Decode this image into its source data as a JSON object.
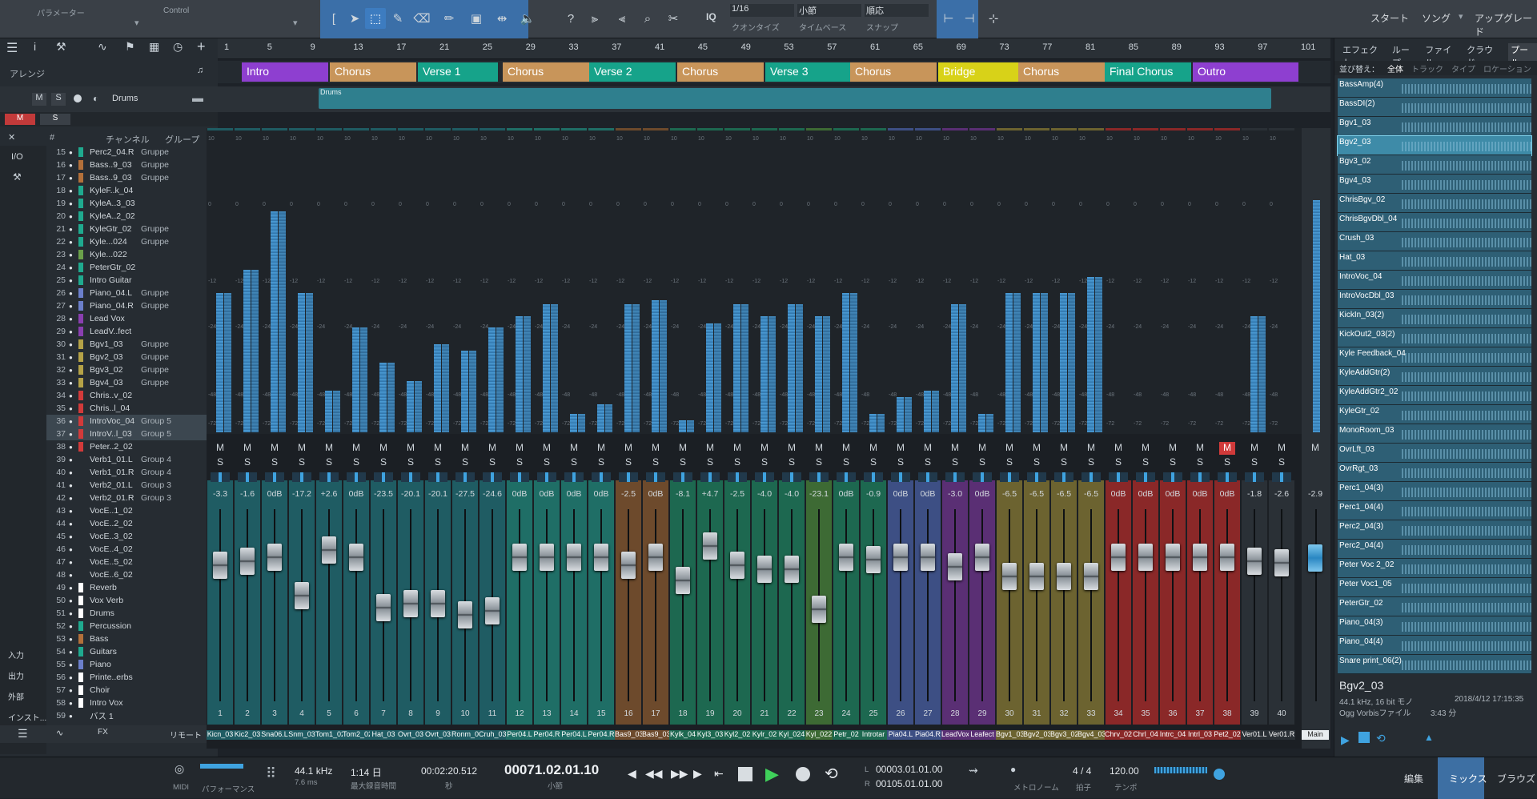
{
  "toolbar": {
    "param_label": "パラメーター",
    "control_label": "Control",
    "iq": "IQ",
    "quantize": "1/16",
    "quantize_label": "クオンタイズ",
    "timebase": "小節",
    "timebase_label": "タイムベース",
    "snap": "順応",
    "snap_label": "スナップ",
    "start": "スタート",
    "song": "ソング",
    "upgrade": "アップグレード"
  },
  "arrange": {
    "label": "アレンジ",
    "ruler": [
      "1",
      "5",
      "9",
      "13",
      "17",
      "21",
      "25",
      "29",
      "33",
      "37",
      "41",
      "45",
      "49",
      "53",
      "57",
      "61",
      "65",
      "69",
      "73",
      "77",
      "81",
      "85",
      "89",
      "93",
      "97",
      "101"
    ],
    "timesig": "4/4",
    "markers": [
      {
        "label": "Intro",
        "color": "#8e3fd0"
      },
      {
        "label": "Chorus",
        "color": "#c8955a"
      },
      {
        "label": "Verse 1",
        "color": "#16a38a"
      },
      {
        "label": "Chorus",
        "color": "#c8955a"
      },
      {
        "label": "Verse 2",
        "color": "#16a38a"
      },
      {
        "label": "Chorus",
        "color": "#c8955a"
      },
      {
        "label": "Verse 3",
        "color": "#16a38a"
      },
      {
        "label": "Chorus",
        "color": "#c8955a"
      },
      {
        "label": "Bridge",
        "color": "#d8d218"
      },
      {
        "label": "Chorus",
        "color": "#c8955a"
      },
      {
        "label": "Final Chorus",
        "color": "#16a38a"
      },
      {
        "label": "Outro",
        "color": "#8e3fd0"
      }
    ]
  },
  "track": {
    "name": "Drums",
    "clip": "Drums",
    "m": "M",
    "s": "S"
  },
  "channels": {
    "col_num": "#",
    "col_channel": "チャンネル",
    "col_group": "グループ",
    "io": "I/O",
    "rows": [
      {
        "n": "15",
        "name": "Perc2_04.R",
        "grp": "Gruppe",
        "c": "#1faa8f"
      },
      {
        "n": "16",
        "name": "Bass..9_03",
        "grp": "Gruppe",
        "c": "#b3703a"
      },
      {
        "n": "17",
        "name": "Bass..9_03",
        "grp": "Gruppe",
        "c": "#b3703a"
      },
      {
        "n": "18",
        "name": "KyleF..k_04",
        "grp": "",
        "c": "#1faa8f"
      },
      {
        "n": "19",
        "name": "KyleA..3_03",
        "grp": "",
        "c": "#1faa8f"
      },
      {
        "n": "20",
        "name": "KyleA..2_02",
        "grp": "",
        "c": "#1faa8f"
      },
      {
        "n": "21",
        "name": "KyleGtr_02",
        "grp": "Gruppe",
        "c": "#1faa8f"
      },
      {
        "n": "22",
        "name": "Kyle...024",
        "grp": "Gruppe",
        "c": "#1faa8f"
      },
      {
        "n": "23",
        "name": "Kyle...022",
        "grp": "",
        "c": "#6aa04a"
      },
      {
        "n": "24",
        "name": "PeterGtr_02",
        "grp": "",
        "c": "#1faa8f"
      },
      {
        "n": "25",
        "name": "Intro Guitar",
        "grp": "",
        "c": "#1faa8f"
      },
      {
        "n": "26",
        "name": "Piano_04.L",
        "grp": "Gruppe",
        "c": "#6b7fcb"
      },
      {
        "n": "27",
        "name": "Piano_04.R",
        "grp": "Gruppe",
        "c": "#6b7fcb"
      },
      {
        "n": "28",
        "name": "Lead Vox",
        "grp": "",
        "c": "#8a3fb0"
      },
      {
        "n": "29",
        "name": "LeadV..fect",
        "grp": "",
        "c": "#8a3fb0"
      },
      {
        "n": "30",
        "name": "Bgv1_03",
        "grp": "Gruppe",
        "c": "#b5a247"
      },
      {
        "n": "31",
        "name": "Bgv2_03",
        "grp": "Gruppe",
        "c": "#b5a247"
      },
      {
        "n": "32",
        "name": "Bgv3_02",
        "grp": "Gruppe",
        "c": "#b5a247"
      },
      {
        "n": "33",
        "name": "Bgv4_03",
        "grp": "Gruppe",
        "c": "#b5a247"
      },
      {
        "n": "34",
        "name": "Chris..v_02",
        "grp": "",
        "c": "#d23a3a"
      },
      {
        "n": "35",
        "name": "Chris..l_04",
        "grp": "",
        "c": "#d23a3a"
      },
      {
        "n": "36",
        "name": "IntroVoc_04",
        "grp": "Group 5",
        "c": "#d23a3a"
      },
      {
        "n": "37",
        "name": "IntroV..l_03",
        "grp": "Group 5",
        "c": "#d23a3a"
      },
      {
        "n": "38",
        "name": "Peter..2_02",
        "grp": "",
        "c": "#d23a3a"
      },
      {
        "n": "39",
        "name": "Verb1_01.L",
        "grp": "Group 4",
        "c": ""
      },
      {
        "n": "40",
        "name": "Verb1_01.R",
        "grp": "Group 4",
        "c": ""
      },
      {
        "n": "41",
        "name": "Verb2_01.L",
        "grp": "Group 3",
        "c": ""
      },
      {
        "n": "42",
        "name": "Verb2_01.R",
        "grp": "Group 3",
        "c": ""
      },
      {
        "n": "43",
        "name": "VocE..1_02",
        "grp": "",
        "c": ""
      },
      {
        "n": "44",
        "name": "VocE..2_02",
        "grp": "",
        "c": ""
      },
      {
        "n": "45",
        "name": "VocE..3_02",
        "grp": "",
        "c": ""
      },
      {
        "n": "46",
        "name": "VocE..4_02",
        "grp": "",
        "c": ""
      },
      {
        "n": "47",
        "name": "VocE..5_02",
        "grp": "",
        "c": ""
      },
      {
        "n": "48",
        "name": "VocE..6_02",
        "grp": "",
        "c": ""
      },
      {
        "n": "49",
        "name": "Reverb",
        "grp": "",
        "c": "#ffffff"
      },
      {
        "n": "50",
        "name": "Vox Verb",
        "grp": "",
        "c": "#ffffff"
      },
      {
        "n": "51",
        "name": "Drums",
        "grp": "",
        "c": "#ffffff"
      },
      {
        "n": "52",
        "name": "Percussion",
        "grp": "",
        "c": "#1faa8f"
      },
      {
        "n": "53",
        "name": "Bass",
        "grp": "",
        "c": "#b3703a"
      },
      {
        "n": "54",
        "name": "Guitars",
        "grp": "",
        "c": "#1faa8f"
      },
      {
        "n": "55",
        "name": "Piano",
        "grp": "",
        "c": "#6b7fcb"
      },
      {
        "n": "56",
        "name": "Printe..erbs",
        "grp": "",
        "c": "#ffffff"
      },
      {
        "n": "57",
        "name": "Choir",
        "grp": "",
        "c": "#ffffff"
      },
      {
        "n": "58",
        "name": "Intro Vox",
        "grp": "",
        "c": "#ffffff"
      },
      {
        "n": "59",
        "name": "バス 1",
        "grp": "",
        "c": ""
      }
    ],
    "side_buttons": [
      "入力",
      "出力",
      "外部",
      "インスト..."
    ]
  },
  "mixer": {
    "strips": [
      {
        "num": "1",
        "db": "-3.3",
        "name": "Kicn_03",
        "color": "#1f5c63",
        "meter": 0.6,
        "fader": 0.78,
        "m": "M",
        "s": "S"
      },
      {
        "num": "2",
        "db": "-1.6",
        "name": "Kic2_03",
        "color": "#1f5c63",
        "meter": 0.7,
        "fader": 0.8,
        "m": "M",
        "s": "S"
      },
      {
        "num": "3",
        "db": "0dB",
        "name": "Sna06.L",
        "color": "#1f5c63",
        "meter": 0.95,
        "fader": 0.82,
        "m": "M",
        "s": "S"
      },
      {
        "num": "4",
        "db": "-17.2",
        "name": "Snm_03",
        "color": "#1f5c63",
        "meter": 0.6,
        "fader": 0.62,
        "m": "M",
        "s": "S"
      },
      {
        "num": "5",
        "db": "+2.6",
        "name": "Tom1_02",
        "color": "#1f5c63",
        "meter": 0.18,
        "fader": 0.86,
        "m": "M",
        "s": "S"
      },
      {
        "num": "6",
        "db": "0dB",
        "name": "Tom2_02",
        "color": "#1f5c63",
        "meter": 0.45,
        "fader": 0.82,
        "m": "M",
        "s": "S"
      },
      {
        "num": "7",
        "db": "-23.5",
        "name": "Hat_03",
        "color": "#1f5c63",
        "meter": 0.3,
        "fader": 0.56,
        "m": "M",
        "s": "S"
      },
      {
        "num": "8",
        "db": "-20.1",
        "name": "Ovrt_03",
        "color": "#1f5c63",
        "meter": 0.22,
        "fader": 0.58,
        "m": "M",
        "s": "S"
      },
      {
        "num": "9",
        "db": "-20.1",
        "name": "Ovrt_03",
        "color": "#1f5c63",
        "meter": 0.38,
        "fader": 0.58,
        "m": "M",
        "s": "S"
      },
      {
        "num": "10",
        "db": "-27.5",
        "name": "Ronm_0",
        "color": "#1f5c63",
        "meter": 0.35,
        "fader": 0.52,
        "m": "M",
        "s": "S"
      },
      {
        "num": "11",
        "db": "-24.6",
        "name": "Cruh_03",
        "color": "#1f5c63",
        "meter": 0.45,
        "fader": 0.54,
        "m": "M",
        "s": "S"
      },
      {
        "num": "12",
        "db": "0dB",
        "name": "Per04.L",
        "color": "#1f6e66",
        "meter": 0.5,
        "fader": 0.82,
        "m": "M",
        "s": "S"
      },
      {
        "num": "13",
        "db": "0dB",
        "name": "Per04.R",
        "color": "#1f6e66",
        "meter": 0.55,
        "fader": 0.82,
        "m": "M",
        "s": "S"
      },
      {
        "num": "14",
        "db": "0dB",
        "name": "Per04.L",
        "color": "#1f6e66",
        "meter": 0.08,
        "fader": 0.82,
        "m": "M",
        "s": "S"
      },
      {
        "num": "15",
        "db": "0dB",
        "name": "Per04.R",
        "color": "#1f6e66",
        "meter": 0.12,
        "fader": 0.82,
        "m": "M",
        "s": "S"
      },
      {
        "num": "16",
        "db": "-2.5",
        "name": "Bas9_03",
        "color": "#6d4a2c",
        "meter": 0.55,
        "fader": 0.78,
        "m": "M",
        "s": "S"
      },
      {
        "num": "17",
        "db": "0dB",
        "name": "Bas9_03",
        "color": "#6d4a2c",
        "meter": 0.57,
        "fader": 0.82,
        "m": "M",
        "s": "S"
      },
      {
        "num": "18",
        "db": "-8.1",
        "name": "Kylk_04",
        "color": "#1d6850",
        "meter": 0.05,
        "fader": 0.7,
        "m": "M",
        "s": "S"
      },
      {
        "num": "19",
        "db": "+4.7",
        "name": "Kyl3_03",
        "color": "#1d6850",
        "meter": 0.47,
        "fader": 0.88,
        "m": "M",
        "s": "S"
      },
      {
        "num": "20",
        "db": "-2.5",
        "name": "Kyl2_02",
        "color": "#1d6850",
        "meter": 0.55,
        "fader": 0.78,
        "m": "M",
        "s": "S"
      },
      {
        "num": "21",
        "db": "-4.0",
        "name": "Kylr_02",
        "color": "#1d6850",
        "meter": 0.5,
        "fader": 0.76,
        "m": "M",
        "s": "S"
      },
      {
        "num": "22",
        "db": "-4.0",
        "name": "Kyl_024",
        "color": "#1d6850",
        "meter": 0.55,
        "fader": 0.76,
        "m": "M",
        "s": "S"
      },
      {
        "num": "23",
        "db": "-23.1",
        "name": "Kyl_022",
        "color": "#3d6a34",
        "meter": 0.5,
        "fader": 0.55,
        "m": "M",
        "s": "S"
      },
      {
        "num": "24",
        "db": "0dB",
        "name": "Petr_02",
        "color": "#1d6850",
        "meter": 0.6,
        "fader": 0.82,
        "m": "M",
        "s": "S"
      },
      {
        "num": "25",
        "db": "-0.9",
        "name": "Introtar",
        "color": "#1d6850",
        "meter": 0.08,
        "fader": 0.81,
        "m": "M",
        "s": "S"
      },
      {
        "num": "26",
        "db": "0dB",
        "name": "Pia04.L",
        "color": "#3d4f84",
        "meter": 0.15,
        "fader": 0.82,
        "m": "M",
        "s": "S"
      },
      {
        "num": "27",
        "db": "0dB",
        "name": "Pia04.R",
        "color": "#3d4f84",
        "meter": 0.18,
        "fader": 0.82,
        "m": "M",
        "s": "S"
      },
      {
        "num": "28",
        "db": "-3.0",
        "name": "LeadVox",
        "color": "#5a2f74",
        "meter": 0.55,
        "fader": 0.77,
        "m": "M",
        "s": "S"
      },
      {
        "num": "29",
        "db": "0dB",
        "name": "Leafect",
        "color": "#5a2f74",
        "meter": 0.08,
        "fader": 0.82,
        "m": "M",
        "s": "S"
      },
      {
        "num": "30",
        "db": "-6.5",
        "name": "Bgv1_03",
        "color": "#6c6330",
        "meter": 0.6,
        "fader": 0.72,
        "m": "M",
        "s": "S"
      },
      {
        "num": "31",
        "db": "-6.5",
        "name": "Bgv2_03",
        "color": "#6c6330",
        "meter": 0.6,
        "fader": 0.72,
        "m": "M",
        "s": "S"
      },
      {
        "num": "32",
        "db": "-6.5",
        "name": "Bgv3_02",
        "color": "#6c6330",
        "meter": 0.6,
        "fader": 0.72,
        "m": "M",
        "s": "S"
      },
      {
        "num": "33",
        "db": "-6.5",
        "name": "Bgv4_03",
        "color": "#6c6330",
        "meter": 0.67,
        "fader": 0.72,
        "m": "M",
        "s": "S"
      },
      {
        "num": "34",
        "db": "0dB",
        "name": "Chrv_02",
        "color": "#8a2828",
        "meter": 0.0,
        "fader": 0.82,
        "m": "M",
        "s": "S"
      },
      {
        "num": "35",
        "db": "0dB",
        "name": "Chrl_04",
        "color": "#8a2828",
        "meter": 0.0,
        "fader": 0.82,
        "m": "M",
        "s": "S"
      },
      {
        "num": "36",
        "db": "0dB",
        "name": "Intrc_04",
        "color": "#8a2828",
        "meter": 0.0,
        "fader": 0.82,
        "m": "M",
        "s": "S"
      },
      {
        "num": "37",
        "db": "0dB",
        "name": "Intrl_03",
        "color": "#8a2828",
        "meter": 0.0,
        "fader": 0.82,
        "m": "M",
        "s": "S"
      },
      {
        "num": "38",
        "db": "0dB",
        "name": "Pet2_02",
        "color": "#8a2828",
        "meter": 0.0,
        "fader": 0.82,
        "m": "M",
        "s": "S"
      },
      {
        "num": "39",
        "db": "-1.8",
        "name": "Ver01.L",
        "color": "#2a3036",
        "meter": 0.5,
        "fader": 0.8,
        "m": "M",
        "s": "S"
      },
      {
        "num": "40",
        "db": "-2.6",
        "name": "Ver01.R",
        "color": "#2a3036",
        "meter": 0.0,
        "fader": 0.79,
        "m": "M",
        "s": "S"
      }
    ],
    "main": {
      "db": "-2.9",
      "name": "Main",
      "m": "M",
      "s": "S"
    }
  },
  "pool": {
    "tabs": [
      "エフェクト",
      "ループ",
      "ファイル",
      "クラウド",
      "プール"
    ],
    "sort_label": "並び替え：",
    "sort_all": "全体",
    "sort_track": "トラック",
    "sort_type": "タイプ",
    "sort_loc": "ロケーション",
    "items": [
      "BassAmp(4)",
      "BassDI(2)",
      "Bgv1_03",
      "Bgv2_03",
      "Bgv3_02",
      "Bgv4_03",
      "ChrisBgv_02",
      "ChrisBgvDbl_04",
      "Crush_03",
      "Hat_03",
      "IntroVoc_04",
      "IntroVocDbl_03",
      "KickIn_03(2)",
      "KickOut2_03(2)",
      "Kyle Feedback_04",
      "KyleAddGtr(2)",
      "KyleAddGtr2_02",
      "KyleGtr_02",
      "MonoRoom_03",
      "OvrLft_03",
      "OvrRgt_03",
      "Perc1_04(3)",
      "Perc1_04(4)",
      "Perc2_04(3)",
      "Perc2_04(4)",
      "Peter Voc 2_02",
      "Peter Voc1_05",
      "PeterGtr_02",
      "Piano_04(3)",
      "Piano_04(4)",
      "Snare print_06(2)"
    ],
    "selected": "Bgv2_03",
    "info_name": "Bgv2_03",
    "info_fmt": "44.1 kHz, 16 bit モノ",
    "info_date": "2018/4/12 17:15:35",
    "info_type": "Ogg Vorbisファイル",
    "info_len": "3:43 分"
  },
  "transport": {
    "midi": "MIDI",
    "perf": "パフォーマンス",
    "rate": "44.1 kHz",
    "rate2": "7.6 ms",
    "rec": "1:14 日",
    "rec_label": "最大録音時間",
    "time": "00:02:20.512",
    "time_label": "秒",
    "bars": "00071.02.01.10",
    "bars_label": "小節",
    "loopL": "00003.01.01.00",
    "loopR": "00105.01.01.00",
    "metronome": "メトロノーム",
    "sig": "4 / 4",
    "sig_label": "拍子",
    "tempo": "120.00",
    "tempo_label": "テンポ",
    "edit": "編集",
    "mix": "ミックス",
    "browse": "ブラウズ",
    "remote": "リモート"
  }
}
